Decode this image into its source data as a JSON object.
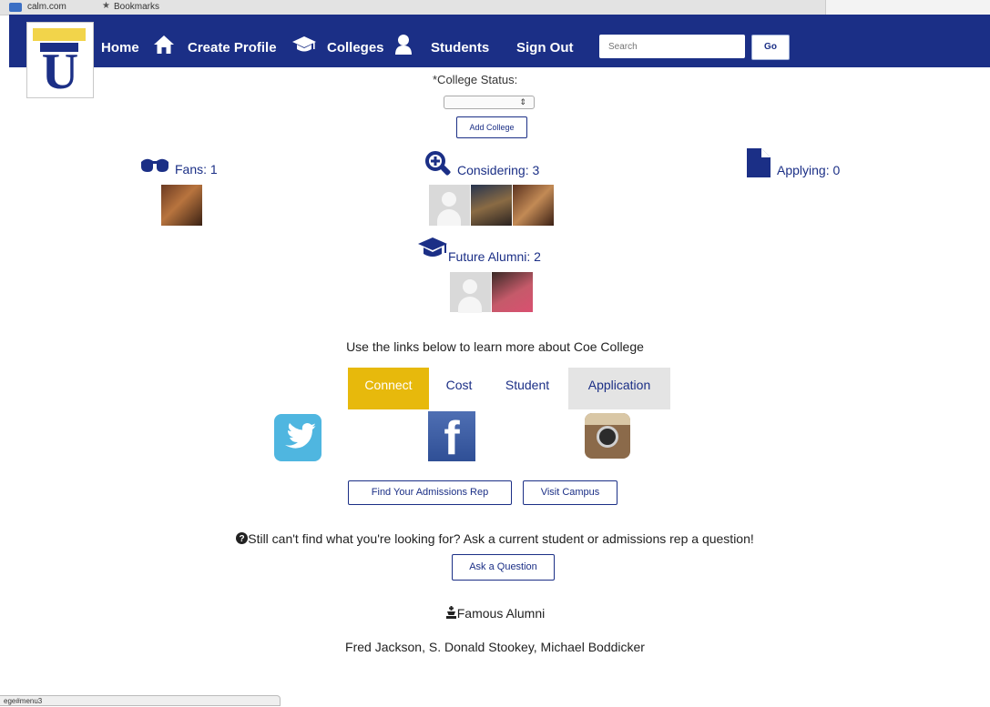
{
  "browser": {
    "bookmark_site": "calm.com",
    "bookmarks_label": "Bookmarks",
    "status_url": "ege#menu3"
  },
  "nav": {
    "items": [
      {
        "label": "Home",
        "icon": "home-icon"
      },
      {
        "label": "Create Profile",
        "icon": "graduation-cap-icon"
      },
      {
        "label": "Colleges",
        "icon": "person-icon"
      },
      {
        "label": "Students"
      },
      {
        "label": "Sign Out"
      }
    ],
    "search_placeholder": "Search",
    "go_label": "Go"
  },
  "college_status": {
    "label": "*College Status:",
    "selected": "",
    "add_button": "Add College"
  },
  "stats": {
    "fans": {
      "label": "Fans: 1",
      "icon": "glasses-icon"
    },
    "considering": {
      "label": "Considering: 3",
      "icon": "magnifier-icon"
    },
    "applying": {
      "label": "Applying: 0",
      "icon": "document-icon"
    },
    "future_alumni": {
      "label": "Future Alumni: 2",
      "icon": "graduation-cap-icon"
    }
  },
  "learn_more": "Use the links below to learn more about Coe College",
  "tabs": [
    {
      "label": "Connect",
      "state": "active"
    },
    {
      "label": "Cost",
      "state": "normal"
    },
    {
      "label": "Student",
      "state": "normal"
    },
    {
      "label": "Application",
      "state": "hover"
    }
  ],
  "social": [
    "twitter-icon",
    "facebook-icon",
    "instagram-icon"
  ],
  "buttons": {
    "admissions_rep": "Find Your Admissions Rep",
    "visit_campus": "Visit Campus",
    "ask_question": "Ask a Question"
  },
  "question_prompt": "Still can't find what you're looking for? Ask a current student or admissions rep a question!",
  "famous_alumni": {
    "heading": "Famous Alumni",
    "names": "Fred Jackson, S. Donald Stookey, Michael Boddicker"
  },
  "colors": {
    "brand_navy": "#1b2f86",
    "accent_gold": "#e7b90c",
    "tab_gray": "#e4e4e4"
  }
}
